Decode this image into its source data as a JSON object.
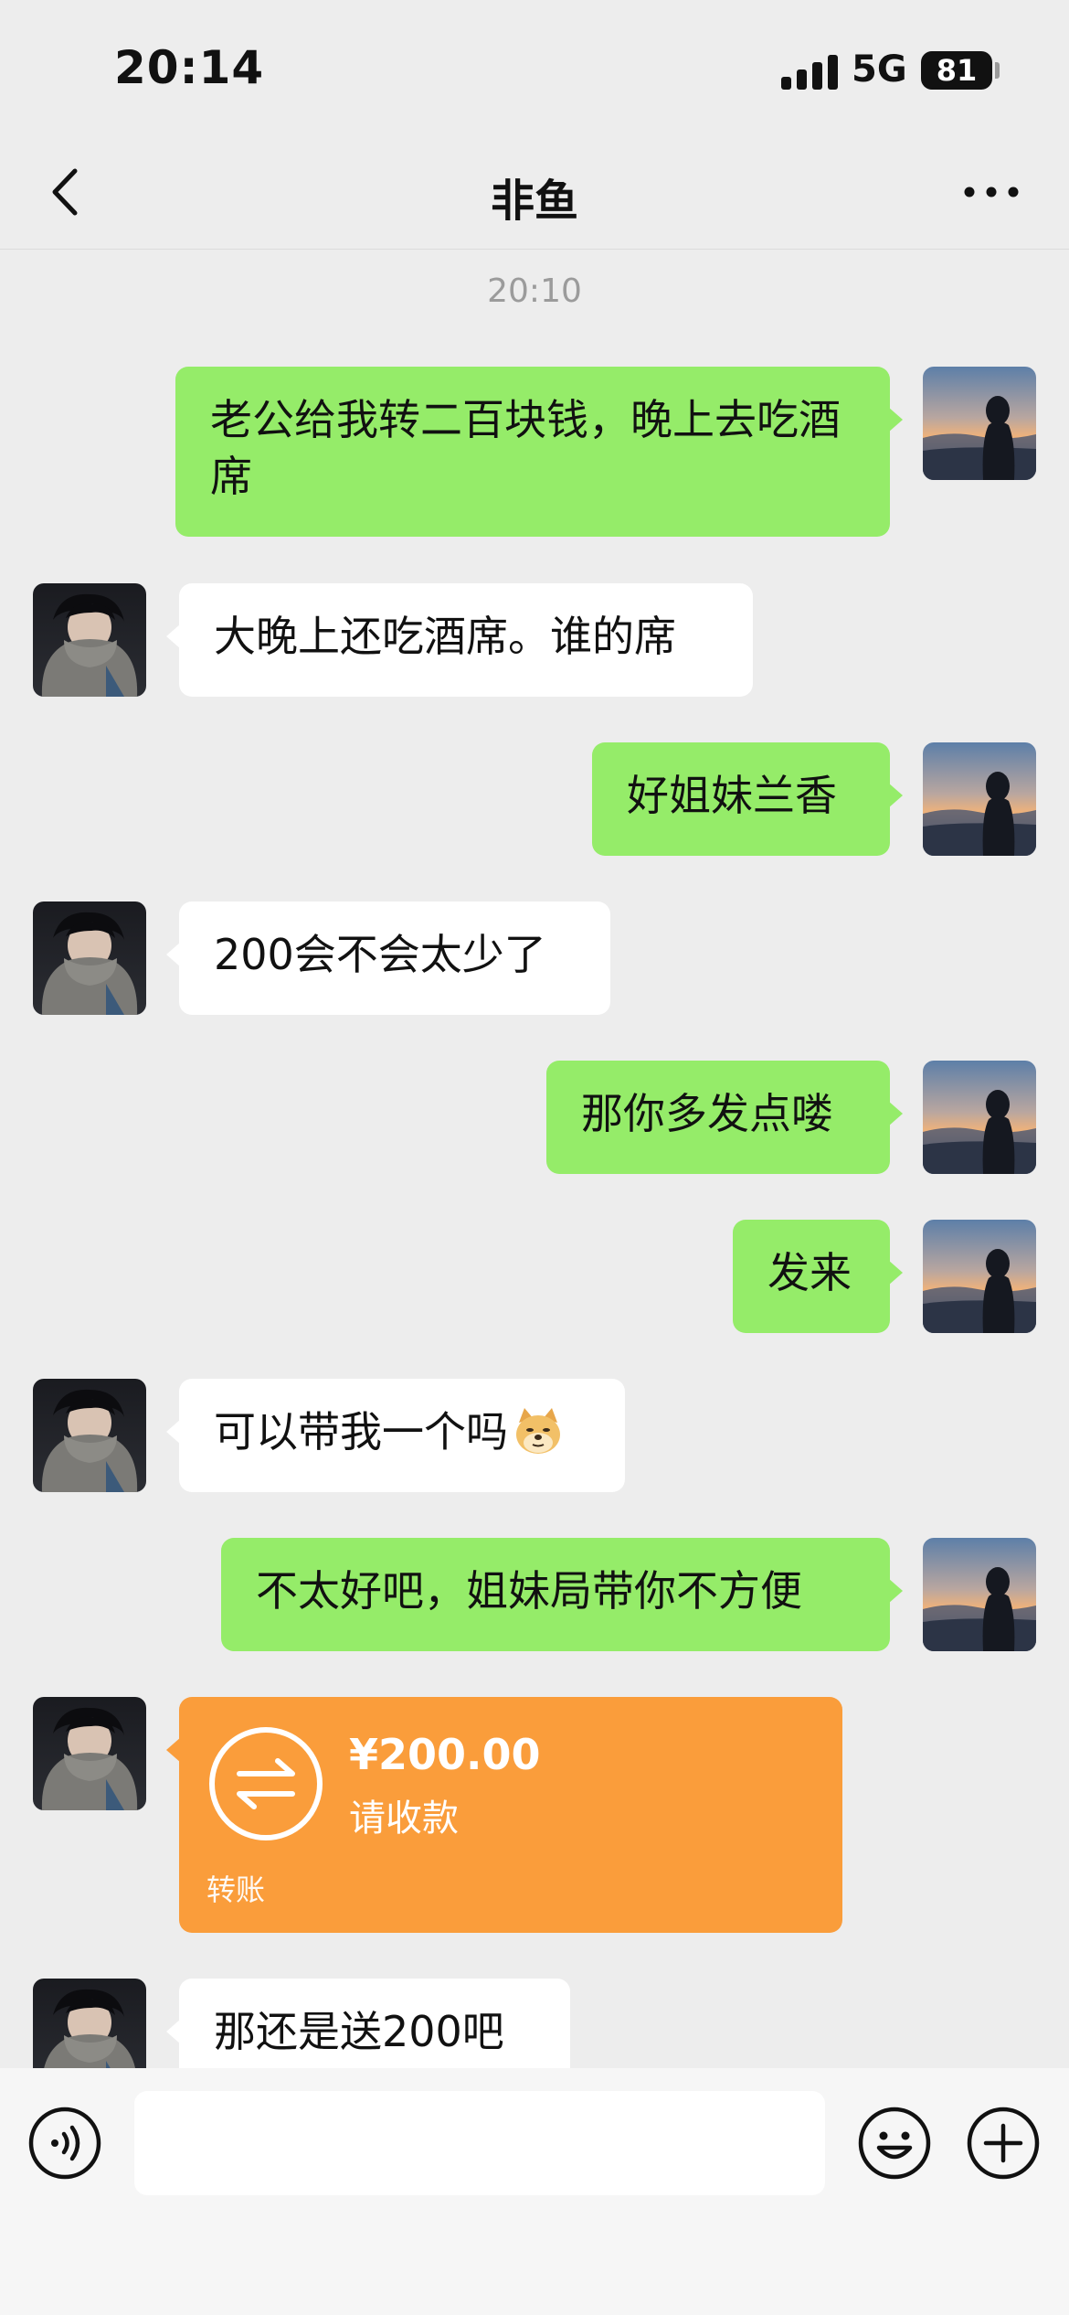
{
  "status_bar": {
    "time": "20:14",
    "network": "5G",
    "battery": "81"
  },
  "header": {
    "title": "非鱼"
  },
  "conversation": {
    "timestamp": "20:10",
    "messages": [
      {
        "from": "me",
        "text": "老公给我转二百块钱，晚上去吃酒席"
      },
      {
        "from": "other",
        "text": "大晚上还吃酒席。谁的席"
      },
      {
        "from": "me",
        "text": "好姐妹兰香"
      },
      {
        "from": "other",
        "text": "200会不会太少了"
      },
      {
        "from": "me",
        "text": "那你多发点喽"
      },
      {
        "from": "me",
        "text": "发来"
      },
      {
        "from": "other",
        "text": "可以带我一个吗",
        "emoji": "doge-emoji"
      },
      {
        "from": "me",
        "text": "不太好吧，姐妹局带你不方便"
      },
      {
        "from": "other",
        "type": "transfer",
        "amount": "¥200.00",
        "status": "请收款",
        "label": "转账"
      },
      {
        "from": "other",
        "text": "那还是送200吧"
      }
    ]
  },
  "input_bar": {
    "value": "",
    "icons": [
      "voice-icon",
      "emoji-icon",
      "plus-icon"
    ]
  },
  "colors": {
    "sent_bubble": "#95ec69",
    "received_bubble": "#ffffff",
    "transfer": "#fa9d3b",
    "background": "#ededed"
  }
}
